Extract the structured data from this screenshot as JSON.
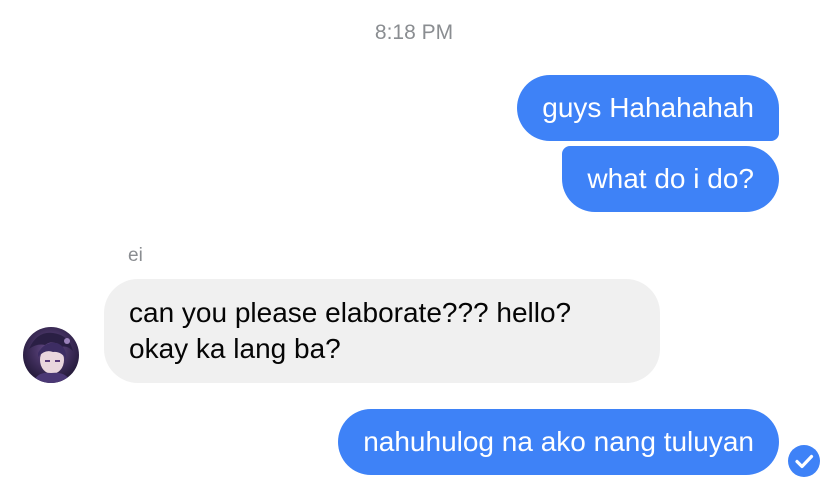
{
  "conversation": {
    "timestamp": "8:18 PM",
    "messages": [
      {
        "direction": "outgoing",
        "text": "guys Hahahahah"
      },
      {
        "direction": "outgoing",
        "text": "what do i do?"
      },
      {
        "direction": "incoming",
        "sender": "ei",
        "text": "can you please elaborate??? hello? okay ka lang ba?"
      },
      {
        "direction": "outgoing",
        "text": "nahuhulog na ako nang tuluyan"
      }
    ]
  },
  "icons": {
    "avatar": "avatar-icon",
    "seen": "checkmark-circle-icon"
  },
  "colors": {
    "outgoing_bubble": "#3e82f7",
    "incoming_bubble": "#f0f0f0",
    "meta_text": "#8a8d91"
  }
}
